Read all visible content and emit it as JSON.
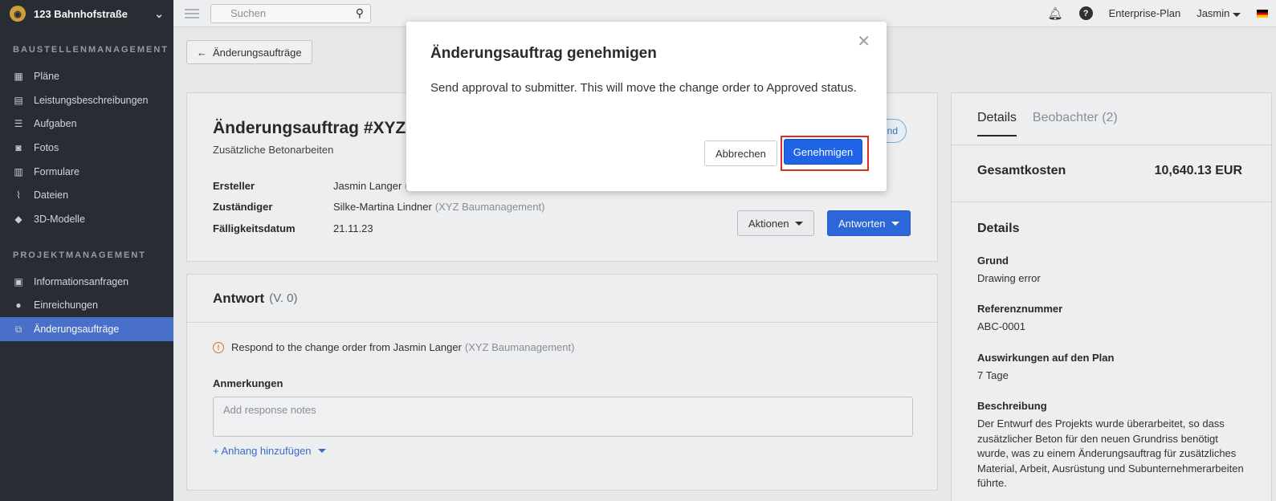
{
  "sidebar": {
    "project_name": "123 Bahnhofstraße",
    "section1": "BAUSTELLENMANAGEMENT",
    "items1": [
      {
        "label": "Pläne",
        "icon": "plans-icon"
      },
      {
        "label": "Leistungsbeschreibungen",
        "icon": "specifications-icon"
      },
      {
        "label": "Aufgaben",
        "icon": "tasks-icon"
      },
      {
        "label": "Fotos",
        "icon": "camera-icon"
      },
      {
        "label": "Formulare",
        "icon": "forms-icon"
      },
      {
        "label": "Dateien",
        "icon": "paperclip-icon"
      },
      {
        "label": "3D-Modelle",
        "icon": "cube-icon"
      }
    ],
    "section2": "PROJEKTMANAGEMENT",
    "items2": [
      {
        "label": "Informationsanfragen",
        "icon": "rfi-icon"
      },
      {
        "label": "Einreichungen",
        "icon": "submittals-icon"
      },
      {
        "label": "Änderungsaufträge",
        "icon": "change-orders-icon",
        "active": true
      }
    ]
  },
  "topbar": {
    "search_placeholder": "Suchen",
    "plan": "Enterprise-Plan",
    "user": "Jasmin"
  },
  "back_button": "Änderungsaufträge",
  "change_order": {
    "title": "Änderungsauftrag #XYZ-00",
    "subtitle": "Zusätzliche Betonarbeiten",
    "pill_partial": "nd",
    "meta": [
      {
        "key": "Ersteller",
        "value": "Jasmin Langer",
        "org": "(X"
      },
      {
        "key": "Zuständiger",
        "value": "Silke-Martina Lindner",
        "org": "(XYZ Baumanagement)"
      },
      {
        "key": "Fälligkeitsdatum",
        "value": "21.11.23",
        "org": ""
      }
    ],
    "actions_label": "Aktionen",
    "reply_label": "Antworten"
  },
  "answer": {
    "title": "Antwort",
    "version": "(V. 0)",
    "notice": "Respond to the change order from Jasmin Langer",
    "notice_org": "(XYZ Baumanagement)",
    "notes_label": "Anmerkungen",
    "notes_placeholder": "Add response notes",
    "attach_label": "+ Anhang hinzufügen"
  },
  "details_panel": {
    "tab_details": "Details",
    "tab_watchers": "Beobachter",
    "tab_watchers_count": "(2)",
    "total_label": "Gesamtkosten",
    "total_value": "10,640.13 EUR",
    "section_title": "Details",
    "fields": [
      {
        "key": "Grund",
        "value": "Drawing error"
      },
      {
        "key": "Referenznummer",
        "value": "ABC-0001"
      },
      {
        "key": "Auswirkungen auf den Plan",
        "value": "7 Tage"
      },
      {
        "key": "Beschreibung",
        "value": "Der Entwurf des Projekts wurde überarbeitet, so dass zusätzlicher Beton für den neuen Grundriss benötigt wurde, was zu einem Änderungsauftrag für zusätzliches Material, Arbeit, Ausrüstung und Subunternehmerarbeiten führte."
      }
    ]
  },
  "modal": {
    "title": "Änderungsauftrag genehmigen",
    "body": "Send approval to submitter. This will move the change order to Approved status.",
    "cancel_label": "Abbrechen",
    "approve_label": "Genehmigen"
  }
}
